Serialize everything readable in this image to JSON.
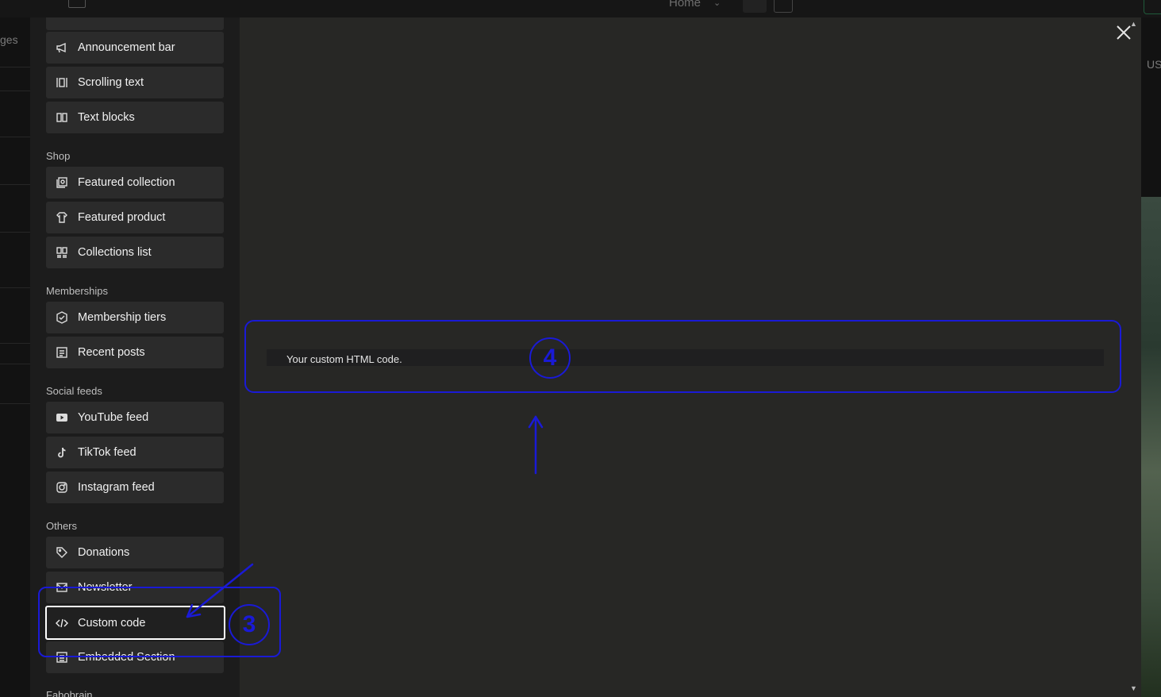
{
  "topbar": {
    "page_selector": "Home"
  },
  "background": {
    "left_fragment": "ges",
    "right_fragment": "US"
  },
  "sidebar": {
    "groups_top": [
      {
        "label": "Announcement bar",
        "icon": "megaphone-icon"
      },
      {
        "label": "Scrolling text",
        "icon": "scrolling-text-icon"
      },
      {
        "label": "Text blocks",
        "icon": "text-blocks-icon"
      }
    ],
    "shop": {
      "heading": "Shop",
      "items": [
        {
          "label": "Featured collection",
          "icon": "collection-icon"
        },
        {
          "label": "Featured product",
          "icon": "shirt-icon"
        },
        {
          "label": "Collections list",
          "icon": "collections-list-icon"
        }
      ]
    },
    "memberships": {
      "heading": "Memberships",
      "items": [
        {
          "label": "Membership tiers",
          "icon": "badge-icon"
        },
        {
          "label": "Recent posts",
          "icon": "posts-icon"
        }
      ]
    },
    "social": {
      "heading": "Social feeds",
      "items": [
        {
          "label": "YouTube feed",
          "icon": "youtube-icon"
        },
        {
          "label": "TikTok feed",
          "icon": "tiktok-icon"
        },
        {
          "label": "Instagram feed",
          "icon": "instagram-icon"
        }
      ]
    },
    "others": {
      "heading": "Others",
      "items": [
        {
          "label": "Donations",
          "icon": "tag-icon"
        },
        {
          "label": "Newsletter",
          "icon": "envelope-icon"
        },
        {
          "label": "Custom code",
          "icon": "code-icon",
          "selected": true
        },
        {
          "label": "Embedded Section",
          "icon": "embed-icon"
        }
      ]
    },
    "next_heading_partial": "Fabobrain"
  },
  "preview": {
    "code_text": "Your custom HTML code."
  },
  "annotations": {
    "step_3": "3",
    "step_4": "4",
    "color": "#1a1ad6"
  }
}
